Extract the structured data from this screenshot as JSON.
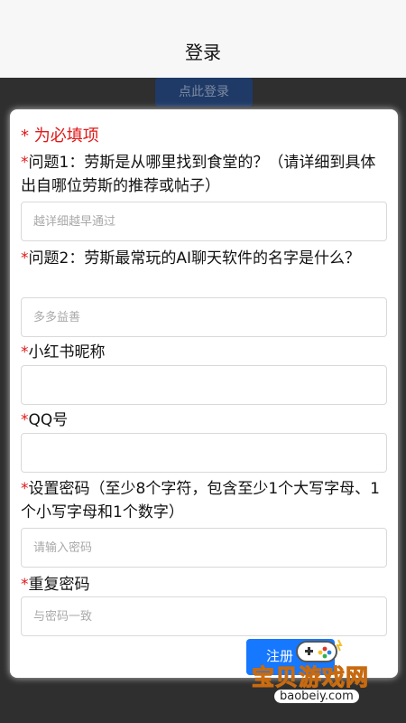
{
  "header": {
    "title": "登录"
  },
  "background": {
    "login_button_label": "点此登录"
  },
  "form": {
    "required_note": "* 为必填项",
    "star": "*",
    "q1": {
      "label": "问题1：劳斯是从哪里找到食堂的？（请详细到具体出自哪位劳斯的推荐或帖子）",
      "placeholder": "越详细越早通过"
    },
    "q2": {
      "label": "问题2：劳斯最常玩的AI聊天软件的名字是什么？",
      "placeholder": "多多益善"
    },
    "nickname": {
      "label": "小红书昵称",
      "placeholder": ""
    },
    "qq": {
      "label": "QQ号",
      "placeholder": ""
    },
    "password": {
      "label": "设置密码（至少8个字符，包含至少1个大写字母、1个小写字母和1个数字）",
      "placeholder": "请输入密码"
    },
    "confirm": {
      "label": "重复密码",
      "placeholder": "与密码一致"
    },
    "submit_label": "注册"
  },
  "watermark": {
    "brand": "宝贝游戏网",
    "url": "baobeiy.com"
  },
  "colors": {
    "accent": "#1677ff",
    "required": "#e01818",
    "overlay": "#2f2f2f"
  }
}
